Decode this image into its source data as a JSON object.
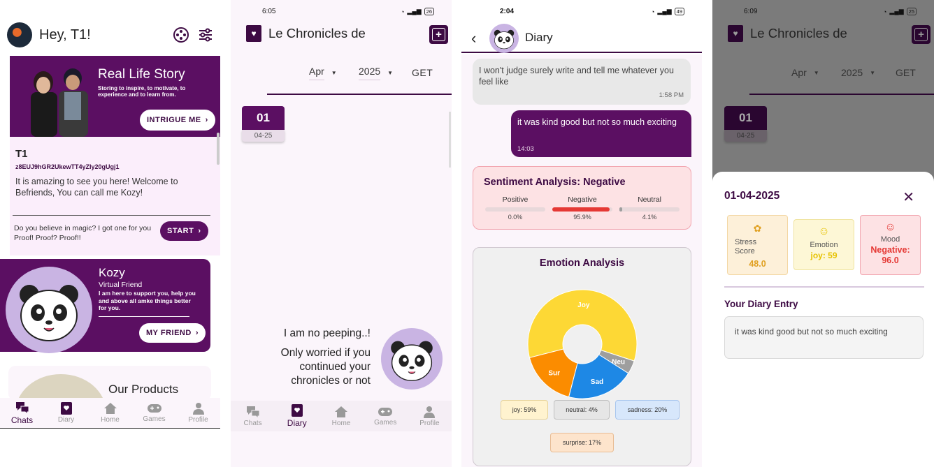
{
  "screen1": {
    "greeting": "Hey, T1!",
    "real_life": {
      "title": "Real Life Story",
      "subtitle": "Storing to inspire, to motivate, to experience and to learn from.",
      "button": "INTRIGUE ME"
    },
    "profile": {
      "name": "T1",
      "id": "z8EUJ9hGR2UkewTT4yZly20gUgj1",
      "message": "It is amazing to see you here! Welcome to Befriends,  You can call me Kozy!"
    },
    "magic": {
      "text": "Do you believe in magic? I got one for you Proof! Proof? Proof!!",
      "button": "START"
    },
    "kozy": {
      "name": "Kozy",
      "role": "Virtual Friend",
      "desc": "I am here to support you, help you and above all amke things better for you.",
      "button": "MY FRIEND"
    },
    "products": {
      "title": "Our Products"
    },
    "nav": [
      {
        "label": "Chats",
        "icon": "chats-icon",
        "active": true
      },
      {
        "label": "Diary",
        "icon": "diary-icon",
        "active": false
      },
      {
        "label": "Home",
        "icon": "home-icon",
        "active": false
      },
      {
        "label": "Games",
        "icon": "games-icon",
        "active": false
      },
      {
        "label": "Profile",
        "icon": "profile-icon",
        "active": false
      }
    ]
  },
  "screen2": {
    "time": "6:05",
    "battery": "26",
    "title": "Le Chronicles de",
    "month": "Apr",
    "year": "2025",
    "get_label": "GET",
    "entry": {
      "day": "01",
      "date": "04-25"
    },
    "peep": {
      "line1": "I am no peeping..!",
      "line2": "Only worried if you",
      "line3": "continued your",
      "line4": "chronicles or not"
    },
    "nav": [
      {
        "label": "Chats",
        "icon": "chats-icon",
        "active": false
      },
      {
        "label": "Diary",
        "icon": "diary-icon",
        "active": true
      },
      {
        "label": "Home",
        "icon": "home-icon",
        "active": false
      },
      {
        "label": "Games",
        "icon": "games-icon",
        "active": false
      },
      {
        "label": "Profile",
        "icon": "profile-icon",
        "active": false
      }
    ]
  },
  "screen3": {
    "time": "2:04",
    "battery": "49",
    "title": "Diary",
    "incoming": {
      "text": "I won't judge surely write and tell me whatever you feel like",
      "time": "1:58 PM"
    },
    "outgoing": {
      "text": "it was kind good but not so much exciting",
      "time": "14:03"
    },
    "sentiment": {
      "title": "Sentiment Analysis: Negative",
      "items": [
        {
          "label": "Positive",
          "value": "0.0%",
          "fraction": 0.0
        },
        {
          "label": "Negative",
          "value": "95.9%",
          "fraction": 0.959
        },
        {
          "label": "Neutral",
          "value": "4.1%",
          "fraction": 0.041
        }
      ]
    },
    "emotion": {
      "title": "Emotion Analysis",
      "slices": [
        {
          "label": "Joy",
          "value": 59,
          "color": "#fdd835"
        },
        {
          "label": "Neu",
          "value": 4,
          "color": "#9e9e9e"
        },
        {
          "label": "Sad",
          "value": 20,
          "color": "#1e88e5"
        },
        {
          "label": "Sur",
          "value": 17,
          "color": "#fb8c00"
        }
      ],
      "tags": {
        "joy": "joy: 59%",
        "neutral": "neutral: 4%",
        "sadness": "sadness: 20%",
        "surprise": "surprise: 17%"
      }
    }
  },
  "screen4": {
    "time": "6:09",
    "battery": "25",
    "title": "Le Chronicles de",
    "month": "Apr",
    "year": "2025",
    "get_label": "GET",
    "entry": {
      "day": "01",
      "date": "04-25"
    },
    "sheet": {
      "date": "01-04-2025",
      "stress": {
        "label1": "Stress",
        "label2": "Score",
        "value": "48.0"
      },
      "emotion": {
        "label": "Emotion",
        "value": "joy: 59"
      },
      "mood": {
        "label": "Mood",
        "value1": "Negative:",
        "value2": "96.0"
      },
      "entry_label": "Your Diary Entry",
      "entry_text": "it was kind good but not so much exciting"
    }
  },
  "colors": {
    "primary": "#5b0f62",
    "accent_dark": "#3d0a43",
    "negative": "#e53935"
  }
}
